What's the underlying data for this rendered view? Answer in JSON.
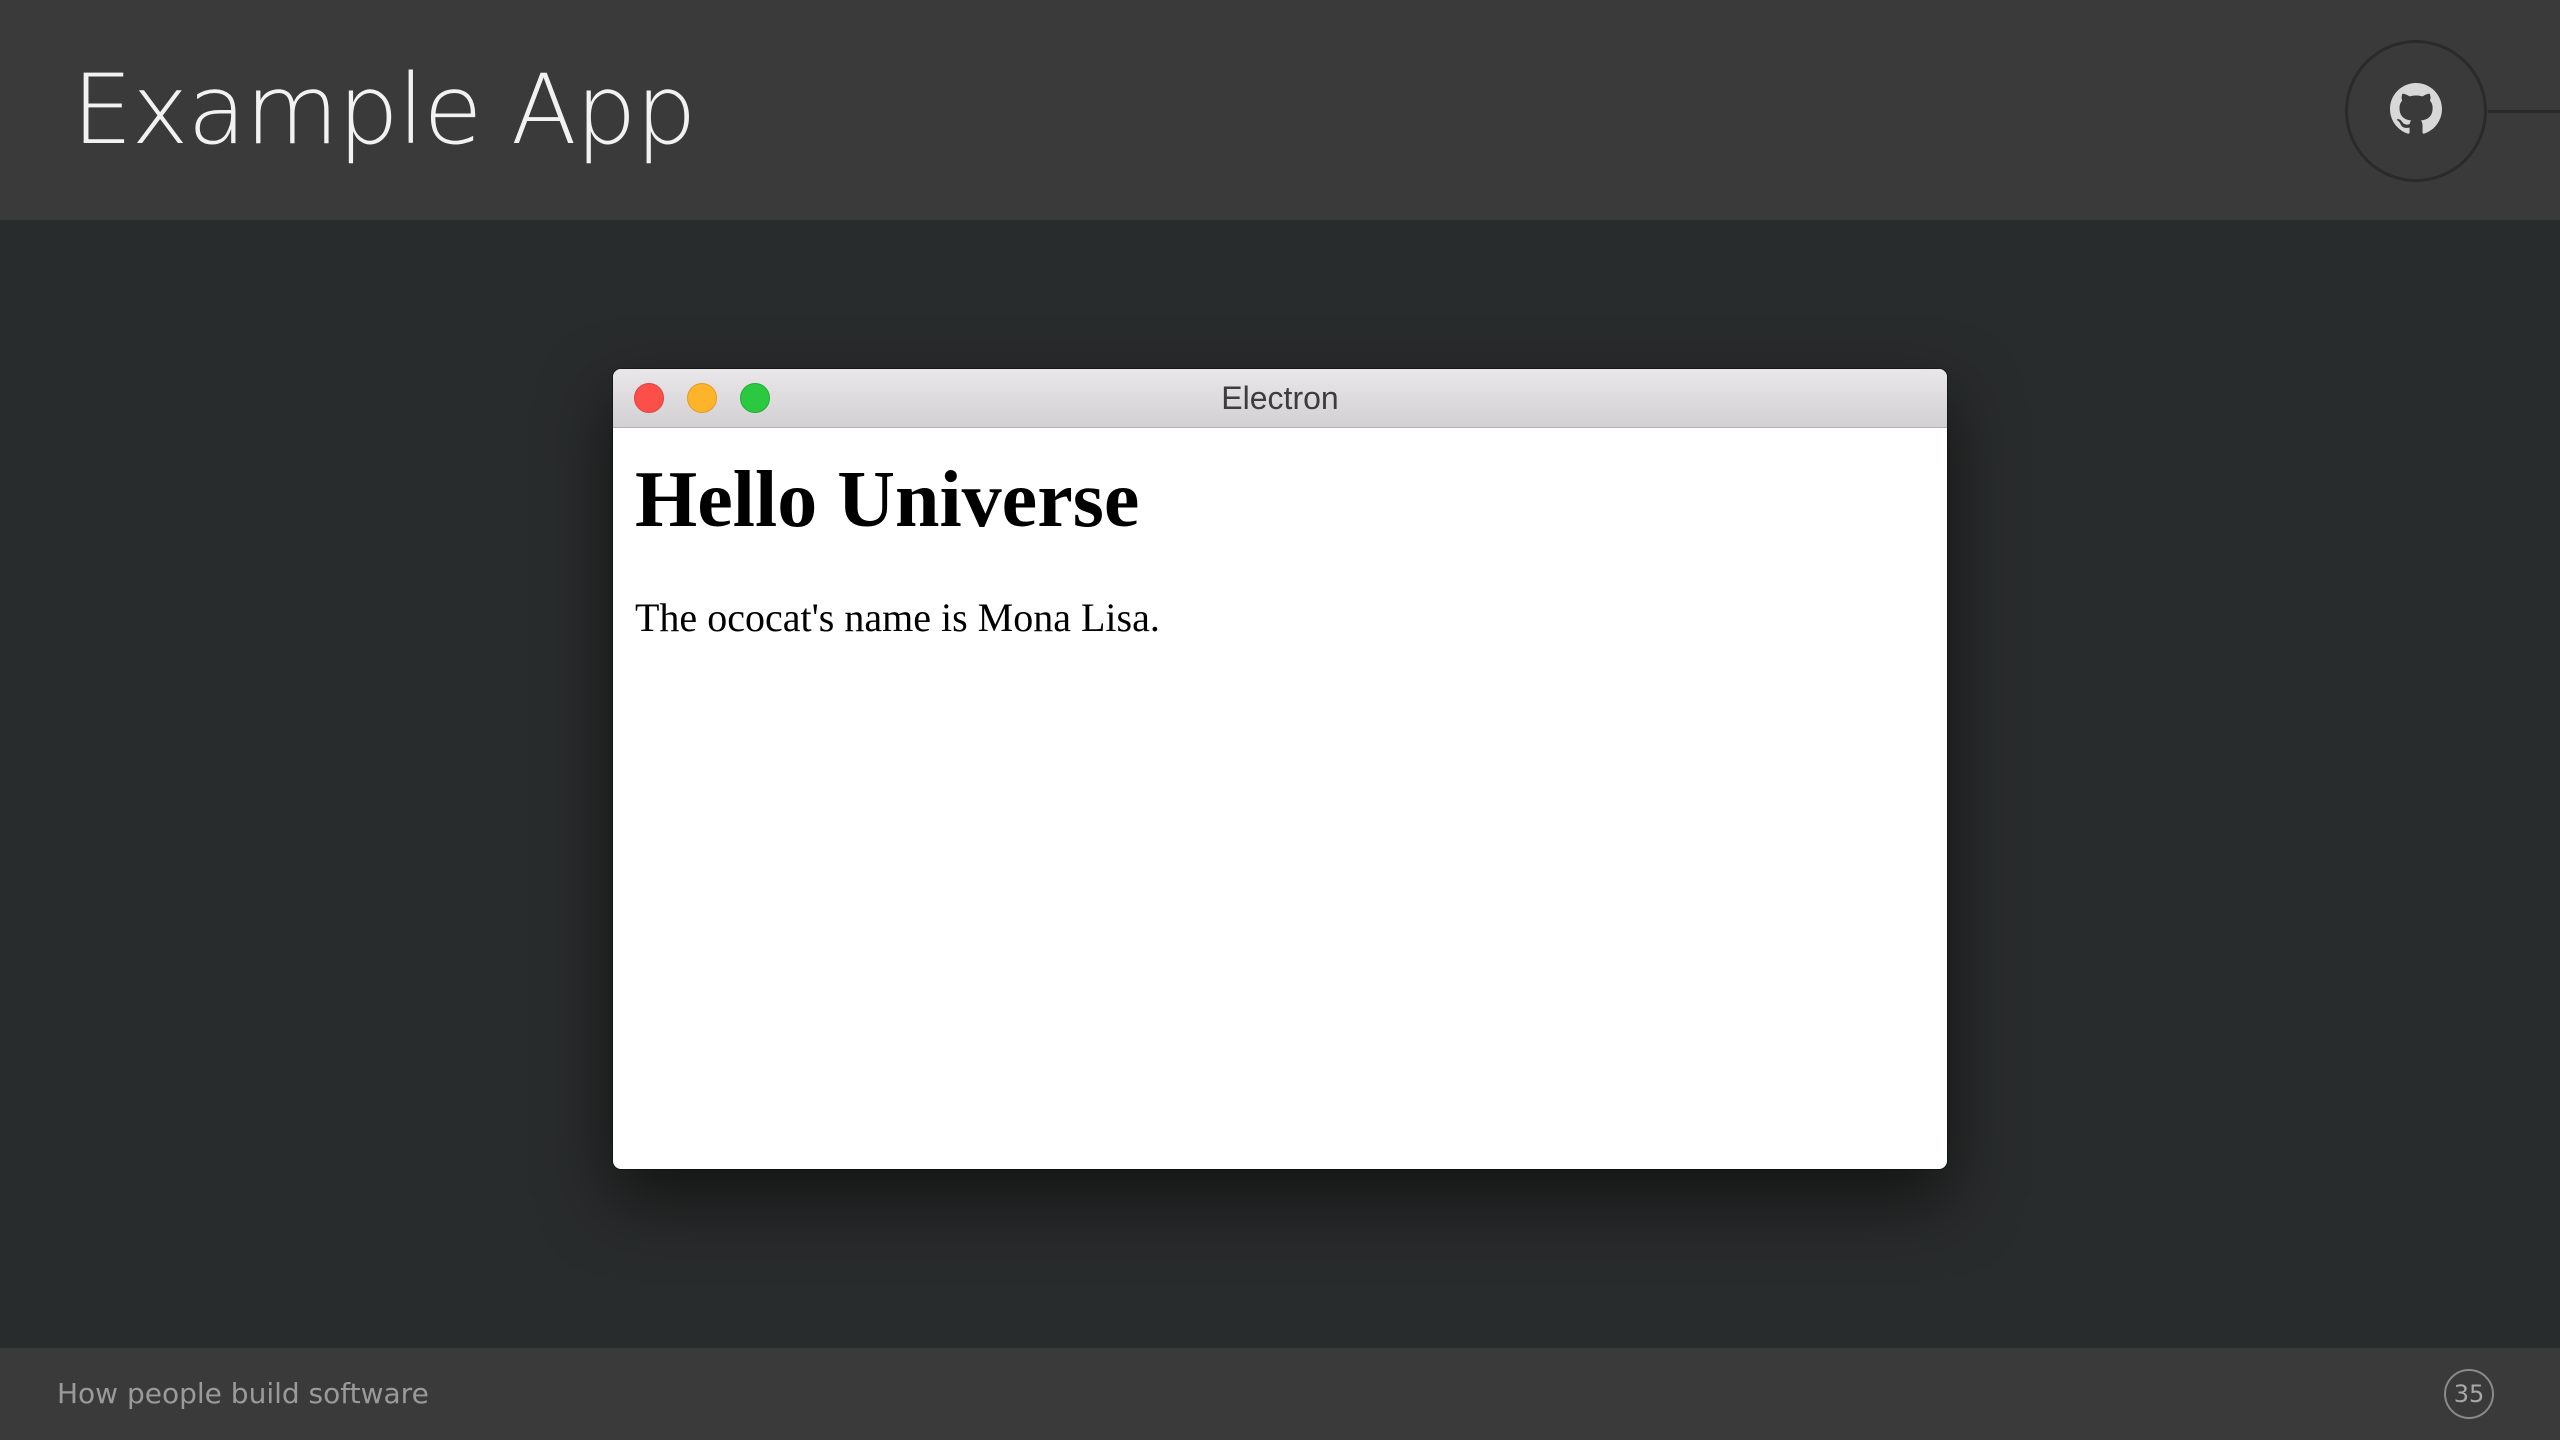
{
  "slide": {
    "title": "Example App",
    "github_icon": "github-icon"
  },
  "window": {
    "title": "Electron",
    "controls": [
      "close-button",
      "minimize-button",
      "maximize-button"
    ],
    "colors": {
      "close": "#fc4f4a",
      "minimize": "#fdb42b",
      "maximize": "#2bc940"
    },
    "content": {
      "heading": "Hello Universe",
      "paragraph": "The ococat's name is Mona Lisa."
    }
  },
  "footer": {
    "text": "How people build software",
    "page_number": "35"
  }
}
